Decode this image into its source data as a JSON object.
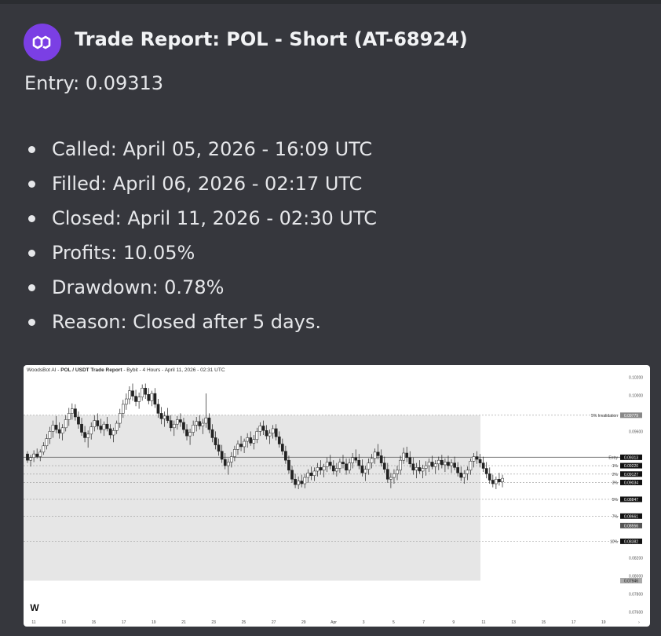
{
  "report": {
    "title": "Trade Report: POL - Short (AT-68924)",
    "entry": "Entry: 0.09313",
    "details": [
      "Called: April 05, 2026 - 16:09 UTC",
      "Filled: April 06, 2026 - 02:17 UTC",
      "Closed: April 11, 2026 - 02:30 UTC",
      "Profits: 10.05%",
      "Drawdown: 0.78%",
      "Reason: Closed after 5 days."
    ]
  },
  "chart_header": {
    "brand": "WoodsBot AI",
    "separator1": " - ",
    "pair": "POL / USDT Trade Report",
    "rest": " - Bybit - 4 Hours - April 11, 2026 - 02:31 UTC"
  },
  "colors": {
    "accent": "#7b3fe4",
    "page_bg": "#36373d"
  },
  "chart_data": {
    "type": "candlestick",
    "x_tick_labels": [
      "11",
      "13",
      "15",
      "17",
      "19",
      "21",
      "23",
      "25",
      "27",
      "29",
      "Apr",
      "3",
      "5",
      "7",
      "9",
      "11",
      "13",
      "15",
      "17",
      "19"
    ],
    "y_tick_labels": [
      "0.10200",
      "0.10000",
      "0.09600",
      "0.08200",
      "0.08000",
      "0.07800",
      "0.07600"
    ],
    "ylim": [
      0.0755,
      0.1023
    ],
    "levels": [
      {
        "label": "5% Invalidation",
        "value": 0.09779,
        "price": "0.09779"
      },
      {
        "label": "Entry",
        "value": 0.09313,
        "price": "0.09313"
      },
      {
        "label": "1%",
        "value": 0.0922,
        "price": "0.09220"
      },
      {
        "label": "2%",
        "value": 0.09127,
        "price": "0.09127"
      },
      {
        "label": "3%",
        "value": 0.09034,
        "price": "0.09034"
      },
      {
        "label": "5%",
        "value": 0.08847,
        "price": "0.08847"
      },
      {
        "label": "7%",
        "value": 0.08661,
        "price": "0.08661"
      },
      {
        "label": "10%",
        "value": 0.08382,
        "price": "0.08382"
      }
    ],
    "current_price": "0.08556",
    "low_marker": "0.07946",
    "highlight_range": {
      "x_start_label": "6",
      "x_end_label": "11",
      "y_top": 0.09779,
      "y_bottom": 0.07946
    },
    "candles": [
      [
        0.0935,
        0.0938,
        0.0925,
        0.0928
      ],
      [
        0.0928,
        0.0934,
        0.0921,
        0.0931
      ],
      [
        0.0931,
        0.0939,
        0.0926,
        0.0935
      ],
      [
        0.0935,
        0.0941,
        0.093,
        0.0932
      ],
      [
        0.0932,
        0.094,
        0.0927,
        0.0937
      ],
      [
        0.0937,
        0.0948,
        0.0934,
        0.0944
      ],
      [
        0.0944,
        0.0957,
        0.094,
        0.0952
      ],
      [
        0.0952,
        0.0965,
        0.0946,
        0.096
      ],
      [
        0.096,
        0.0972,
        0.0953,
        0.0967
      ],
      [
        0.0967,
        0.0977,
        0.0958,
        0.0962
      ],
      [
        0.0962,
        0.097,
        0.0952,
        0.0958
      ],
      [
        0.0958,
        0.0968,
        0.095,
        0.0964
      ],
      [
        0.0964,
        0.0978,
        0.096,
        0.0973
      ],
      [
        0.0973,
        0.0986,
        0.0966,
        0.098
      ],
      [
        0.098,
        0.0991,
        0.0973,
        0.0985
      ],
      [
        0.0985,
        0.099,
        0.0972,
        0.0976
      ],
      [
        0.0976,
        0.0982,
        0.0963,
        0.0968
      ],
      [
        0.0968,
        0.0975,
        0.0955,
        0.0959
      ],
      [
        0.0959,
        0.0966,
        0.0948,
        0.0953
      ],
      [
        0.0953,
        0.0961,
        0.0942,
        0.0957
      ],
      [
        0.0957,
        0.097,
        0.0951,
        0.0965
      ],
      [
        0.0965,
        0.0978,
        0.096,
        0.0972
      ],
      [
        0.0972,
        0.098,
        0.0962,
        0.0966
      ],
      [
        0.0966,
        0.0974,
        0.0958,
        0.0962
      ],
      [
        0.0962,
        0.0971,
        0.0955,
        0.0968
      ],
      [
        0.0968,
        0.0976,
        0.096,
        0.0963
      ],
      [
        0.0963,
        0.0968,
        0.0952,
        0.0956
      ],
      [
        0.0956,
        0.0964,
        0.0948,
        0.0961
      ],
      [
        0.0961,
        0.0972,
        0.0957,
        0.0969
      ],
      [
        0.0969,
        0.0985,
        0.0964,
        0.098
      ],
      [
        0.098,
        0.0995,
        0.0975,
        0.099
      ],
      [
        0.099,
        0.1002,
        0.0984,
        0.0996
      ],
      [
        0.0996,
        0.101,
        0.099,
        0.1005
      ],
      [
        0.1005,
        0.1013,
        0.0994,
        0.0999
      ],
      [
        0.0999,
        0.1006,
        0.0988,
        0.0993
      ],
      [
        0.0993,
        0.1003,
        0.0985,
        0.0998
      ],
      [
        0.0998,
        0.1012,
        0.0994,
        0.1008
      ],
      [
        0.1008,
        0.1013,
        0.0996,
        0.1001
      ],
      [
        0.1001,
        0.1008,
        0.099,
        0.0994
      ],
      [
        0.0994,
        0.1005,
        0.0988,
        0.1002
      ],
      [
        0.1002,
        0.1008,
        0.0986,
        0.099
      ],
      [
        0.099,
        0.0996,
        0.0975,
        0.098
      ],
      [
        0.098,
        0.0987,
        0.0968,
        0.0974
      ],
      [
        0.0974,
        0.0982,
        0.0965,
        0.0977
      ],
      [
        0.0977,
        0.0986,
        0.0969,
        0.0972
      ],
      [
        0.0972,
        0.0978,
        0.096,
        0.0964
      ],
      [
        0.0964,
        0.0972,
        0.0955,
        0.0968
      ],
      [
        0.0968,
        0.0977,
        0.0962,
        0.0973
      ],
      [
        0.0973,
        0.098,
        0.0965,
        0.097
      ],
      [
        0.097,
        0.0975,
        0.0958,
        0.0962
      ],
      [
        0.0962,
        0.0968,
        0.095,
        0.0955
      ],
      [
        0.0955,
        0.0963,
        0.0945,
        0.0959
      ],
      [
        0.0959,
        0.0972,
        0.0955,
        0.0967
      ],
      [
        0.0967,
        0.0976,
        0.096,
        0.0971
      ],
      [
        0.0971,
        0.0978,
        0.0962,
        0.0966
      ],
      [
        0.0966,
        0.0974,
        0.0957,
        0.0969
      ],
      [
        0.0969,
        0.1002,
        0.0964,
        0.0975
      ],
      [
        0.0975,
        0.098,
        0.0958,
        0.0962
      ],
      [
        0.0962,
        0.0968,
        0.0948,
        0.0953
      ],
      [
        0.0953,
        0.096,
        0.094,
        0.0945
      ],
      [
        0.0945,
        0.0952,
        0.0933,
        0.0938
      ],
      [
        0.0938,
        0.0945,
        0.0925,
        0.0929
      ],
      [
        0.0929,
        0.0936,
        0.0918,
        0.0922
      ],
      [
        0.0922,
        0.093,
        0.0912,
        0.0926
      ],
      [
        0.0926,
        0.0937,
        0.092,
        0.0932
      ],
      [
        0.0932,
        0.0944,
        0.0927,
        0.094
      ],
      [
        0.094,
        0.095,
        0.0934,
        0.0946
      ],
      [
        0.0946,
        0.0955,
        0.0938,
        0.0943
      ],
      [
        0.0943,
        0.0952,
        0.0936,
        0.0949
      ],
      [
        0.0949,
        0.0958,
        0.0942,
        0.0953
      ],
      [
        0.0953,
        0.096,
        0.0944,
        0.0947
      ],
      [
        0.0947,
        0.0956,
        0.094,
        0.0951
      ],
      [
        0.0951,
        0.0964,
        0.0947,
        0.096
      ],
      [
        0.096,
        0.097,
        0.0955,
        0.0966
      ],
      [
        0.0966,
        0.0972,
        0.0956,
        0.0961
      ],
      [
        0.0961,
        0.0967,
        0.0951,
        0.0955
      ],
      [
        0.0955,
        0.0962,
        0.0946,
        0.0958
      ],
      [
        0.0958,
        0.0967,
        0.0952,
        0.0963
      ],
      [
        0.0963,
        0.0968,
        0.095,
        0.0954
      ],
      [
        0.0954,
        0.096,
        0.0942,
        0.0946
      ],
      [
        0.0946,
        0.0952,
        0.0934,
        0.0938
      ],
      [
        0.0938,
        0.0944,
        0.0924,
        0.0928
      ],
      [
        0.0928,
        0.0933,
        0.0913,
        0.0917
      ],
      [
        0.0917,
        0.0922,
        0.0903,
        0.0907
      ],
      [
        0.0907,
        0.0913,
        0.0897,
        0.0901
      ],
      [
        0.0901,
        0.091,
        0.0896,
        0.0905
      ],
      [
        0.0905,
        0.0912,
        0.0898,
        0.0902
      ],
      [
        0.0902,
        0.0913,
        0.0897,
        0.0909
      ],
      [
        0.0909,
        0.0918,
        0.0903,
        0.0914
      ],
      [
        0.0914,
        0.0921,
        0.0906,
        0.0911
      ],
      [
        0.0911,
        0.092,
        0.0905,
        0.0916
      ],
      [
        0.0916,
        0.0925,
        0.091,
        0.092
      ],
      [
        0.092,
        0.0928,
        0.0912,
        0.0917
      ],
      [
        0.0917,
        0.0924,
        0.0909,
        0.0921
      ],
      [
        0.0921,
        0.0931,
        0.0915,
        0.0926
      ],
      [
        0.0926,
        0.0934,
        0.0918,
        0.0922
      ],
      [
        0.0922,
        0.0928,
        0.0912,
        0.0916
      ],
      [
        0.0916,
        0.0925,
        0.091,
        0.0919
      ],
      [
        0.0919,
        0.093,
        0.0914,
        0.0926
      ],
      [
        0.0926,
        0.0934,
        0.0919,
        0.0924
      ],
      [
        0.0924,
        0.093,
        0.0912,
        0.0917
      ],
      [
        0.0917,
        0.093,
        0.0913,
        0.0925
      ],
      [
        0.0925,
        0.0936,
        0.0919,
        0.0931
      ],
      [
        0.0931,
        0.094,
        0.0925,
        0.0928
      ],
      [
        0.0928,
        0.0935,
        0.0918,
        0.0922
      ],
      [
        0.0922,
        0.0929,
        0.091,
        0.0914
      ],
      [
        0.0914,
        0.0922,
        0.0905,
        0.0918
      ],
      [
        0.0918,
        0.093,
        0.0912,
        0.0925
      ],
      [
        0.0925,
        0.0935,
        0.0919,
        0.093
      ],
      [
        0.093,
        0.0941,
        0.0924,
        0.0937
      ],
      [
        0.0937,
        0.0946,
        0.0929,
        0.0933
      ],
      [
        0.0933,
        0.094,
        0.0921,
        0.0925
      ],
      [
        0.0925,
        0.0932,
        0.0914,
        0.0918
      ],
      [
        0.0918,
        0.0925,
        0.0903,
        0.0907
      ],
      [
        0.0907,
        0.0914,
        0.0897,
        0.0909
      ],
      [
        0.0909,
        0.0918,
        0.0902,
        0.0913
      ],
      [
        0.0913,
        0.0922,
        0.0906,
        0.0917
      ],
      [
        0.0917,
        0.0933,
        0.0912,
        0.0928
      ],
      [
        0.0928,
        0.0942,
        0.0924,
        0.0936
      ],
      [
        0.0936,
        0.0943,
        0.0926,
        0.0931
      ],
      [
        0.0931,
        0.0938,
        0.092,
        0.0924
      ],
      [
        0.0924,
        0.0931,
        0.0912,
        0.0917
      ],
      [
        0.0917,
        0.0925,
        0.0908,
        0.092
      ],
      [
        0.092,
        0.0928,
        0.0913,
        0.0916
      ],
      [
        0.0916,
        0.0923,
        0.0908,
        0.0919
      ],
      [
        0.0919,
        0.0927,
        0.0911,
        0.0922
      ],
      [
        0.0922,
        0.093,
        0.0915,
        0.0926
      ],
      [
        0.0926,
        0.0933,
        0.0918,
        0.0921
      ],
      [
        0.0921,
        0.0928,
        0.0913,
        0.0924
      ],
      [
        0.0924,
        0.0932,
        0.0917,
        0.0928
      ],
      [
        0.0928,
        0.0934,
        0.0919,
        0.0923
      ],
      [
        0.0923,
        0.093,
        0.0915,
        0.0926
      ],
      [
        0.0926,
        0.0933,
        0.0918,
        0.0922
      ],
      [
        0.0922,
        0.0929,
        0.0914,
        0.0925
      ],
      [
        0.0925,
        0.0932,
        0.0917,
        0.092
      ],
      [
        0.092,
        0.0926,
        0.091,
        0.0914
      ],
      [
        0.0914,
        0.0921,
        0.0905,
        0.0909
      ],
      [
        0.0909,
        0.0917,
        0.0902,
        0.0913
      ],
      [
        0.0913,
        0.0921,
        0.0906,
        0.0917
      ],
      [
        0.0917,
        0.093,
        0.0912,
        0.0927
      ],
      [
        0.0927,
        0.0936,
        0.092,
        0.0932
      ],
      [
        0.0932,
        0.0938,
        0.0924,
        0.0929
      ],
      [
        0.0929,
        0.0935,
        0.092,
        0.0925
      ],
      [
        0.0925,
        0.0932,
        0.0915,
        0.0919
      ],
      [
        0.0919,
        0.0926,
        0.0908,
        0.0913
      ],
      [
        0.0913,
        0.092,
        0.0902,
        0.0906
      ],
      [
        0.0906,
        0.0912,
        0.0898,
        0.0902
      ],
      [
        0.0902,
        0.091,
        0.0896,
        0.0907
      ],
      [
        0.0907,
        0.0914,
        0.09,
        0.0904
      ],
      [
        0.0904,
        0.0912,
        0.0898,
        0.0908
      ]
    ]
  }
}
